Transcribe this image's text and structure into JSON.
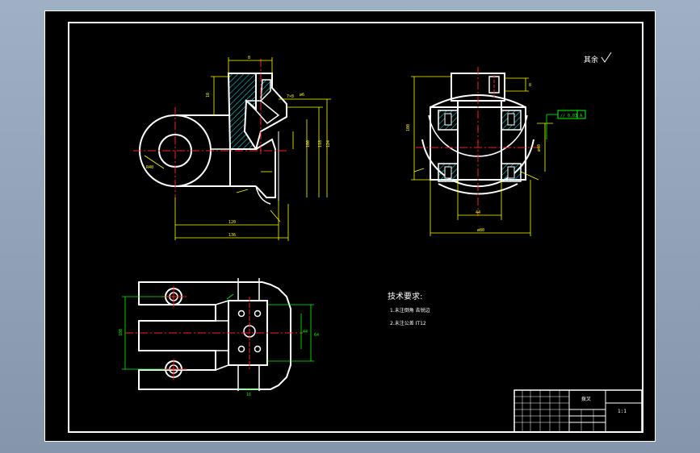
{
  "drawing": {
    "roughness_symbol": "其余",
    "notes_title": "技术要求:",
    "notes": [
      "1.未注倒角 去锐边",
      "2.未注公差 IT12"
    ],
    "tolerance_frame": "// 0.03 A",
    "title_block": {
      "part_name": "拨叉",
      "scale": "1:1"
    }
  },
  "colors": {
    "outline": "#ffffff",
    "dimension": "#ffff00",
    "centerline": "#ff2020",
    "hatch": "#00ffff",
    "callout": "#00ff00"
  }
}
